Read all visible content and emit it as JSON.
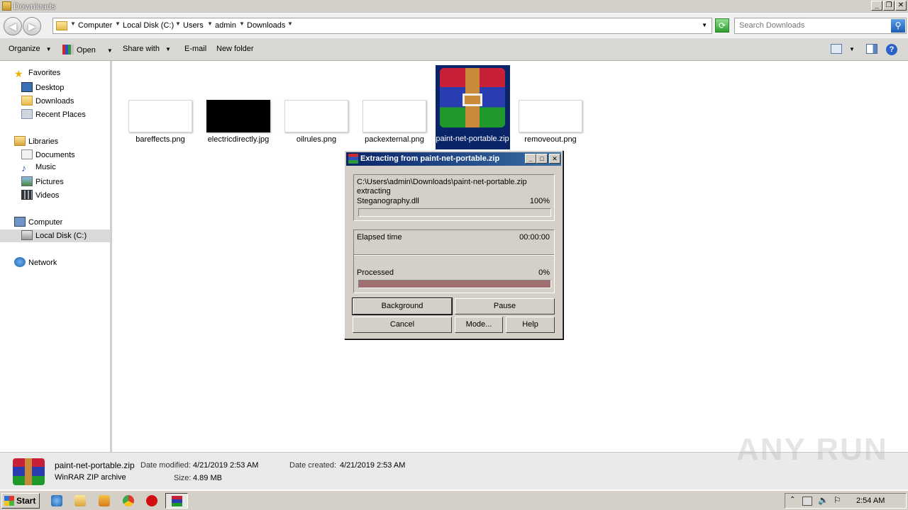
{
  "window": {
    "title": "Downloads",
    "icon": "folder-icon"
  },
  "address": {
    "crumbs": [
      "Computer",
      "Local Disk (C:)",
      "Users",
      "admin",
      "Downloads"
    ]
  },
  "search": {
    "placeholder": "Search Downloads"
  },
  "toolbar": {
    "organize": "Organize",
    "open": "Open",
    "share_with": "Share with",
    "email": "E-mail",
    "new_folder": "New folder"
  },
  "nav": {
    "favorites": "Favorites",
    "desktop": "Desktop",
    "downloads": "Downloads",
    "recent": "Recent Places",
    "libraries": "Libraries",
    "documents": "Documents",
    "music": "Music",
    "pictures": "Pictures",
    "videos": "Videos",
    "computer": "Computer",
    "local_disk": "Local Disk (C:)",
    "network": "Network"
  },
  "files": [
    {
      "name": "bareffects.png"
    },
    {
      "name": "electricdirectly.jpg"
    },
    {
      "name": "oilrules.png"
    },
    {
      "name": "packexternal.png"
    },
    {
      "name": "paint-net-portable.zip",
      "selected": true
    },
    {
      "name": "removeout.png"
    }
  ],
  "details": {
    "filename": "paint-net-portable.zip",
    "type": "WinRAR ZIP archive",
    "date_modified_label": "Date modified:",
    "date_modified": "4/21/2019 2:53 AM",
    "date_created_label": "Date created:",
    "date_created": "4/21/2019 2:53 AM",
    "size_label": "Size:",
    "size": "4.89 MB"
  },
  "dialog": {
    "title": "Extracting from paint-net-portable.zip",
    "path": "C:\\Users\\admin\\Downloads\\paint-net-portable.zip",
    "action": "extracting",
    "current_file": "Steganography.dll",
    "file_percent": "100%",
    "file_progress": 1.0,
    "elapsed_label": "Elapsed time",
    "elapsed": "00:00:00",
    "processed_label": "Processed",
    "processed_percent": "0%",
    "processed_progress": 0.0,
    "buttons": {
      "background": "Background",
      "pause": "Pause",
      "cancel": "Cancel",
      "mode": "Mode...",
      "help": "Help"
    },
    "colors": {
      "processed_bar": "#a07070",
      "title_bar": "#0a246a"
    }
  },
  "taskbar": {
    "start": "Start",
    "clock": "2:54 AM"
  },
  "watermark": "ANY RUN"
}
